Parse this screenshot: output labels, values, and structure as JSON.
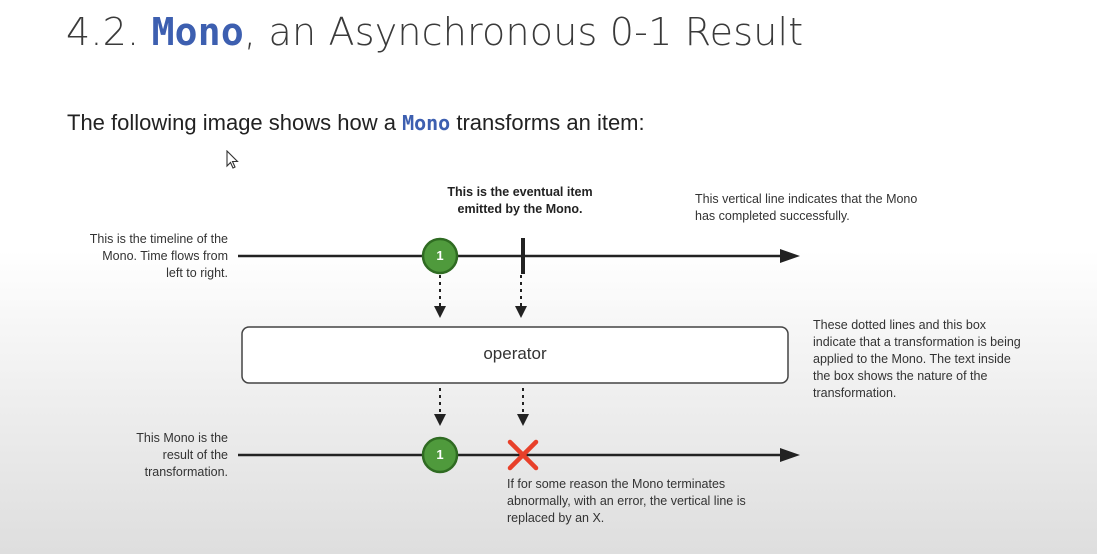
{
  "heading": {
    "prefix": "4.2. ",
    "code": "Mono",
    "suffix": ", an Asynchronous 0-1 Result"
  },
  "intro": {
    "before": "The following image shows how a ",
    "code": "Mono",
    "after": " transforms an item:"
  },
  "diagram": {
    "timeline_note": [
      "This is the timeline of the",
      "Mono. Time flows from",
      "left to right."
    ],
    "item_note": [
      "This is the eventual item",
      "emitted by the Mono."
    ],
    "complete_note": [
      "This vertical line indicates that the Mono",
      "has completed successfully."
    ],
    "operator_label": "operator",
    "operator_note": [
      "These dotted lines and this box",
      "indicate that a transformation is being",
      "applied to the Mono. The text inside",
      "the box shows the nature of the",
      "transformation."
    ],
    "result_note": [
      "This Mono is the",
      "result of the",
      "transformation."
    ],
    "error_note": [
      "If for some reason the Mono terminates",
      "abnormally, with an error, the vertical line is",
      "replaced by an X."
    ],
    "marble_top": "1",
    "marble_bottom": "1"
  },
  "colors": {
    "marble_fill": "#4f9a3c",
    "marble_stroke": "#2f6b22",
    "error_x": "#e8402a",
    "code_blue": "#3d5fb0"
  }
}
